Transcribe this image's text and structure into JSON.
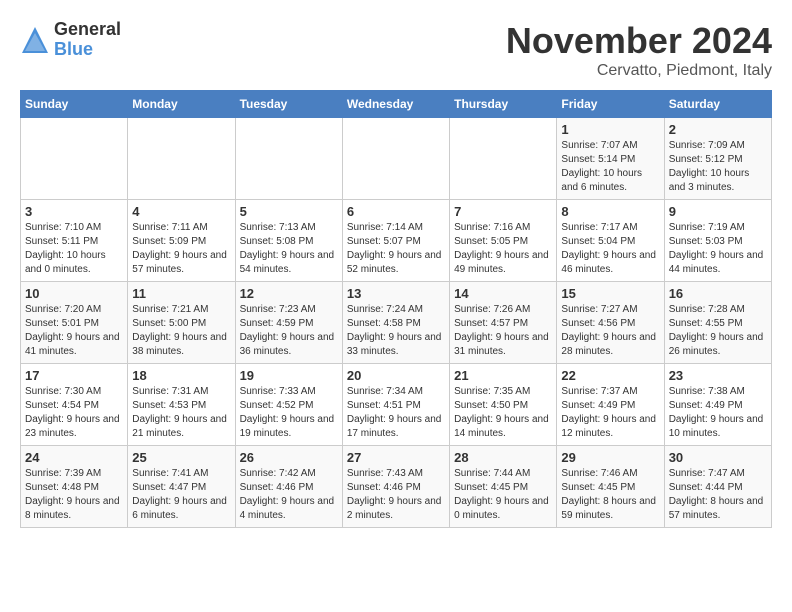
{
  "header": {
    "logo_general": "General",
    "logo_blue": "Blue",
    "month_title": "November 2024",
    "location": "Cervatto, Piedmont, Italy"
  },
  "weekdays": [
    "Sunday",
    "Monday",
    "Tuesday",
    "Wednesday",
    "Thursday",
    "Friday",
    "Saturday"
  ],
  "weeks": [
    [
      {
        "day": "",
        "info": ""
      },
      {
        "day": "",
        "info": ""
      },
      {
        "day": "",
        "info": ""
      },
      {
        "day": "",
        "info": ""
      },
      {
        "day": "",
        "info": ""
      },
      {
        "day": "1",
        "info": "Sunrise: 7:07 AM\nSunset: 5:14 PM\nDaylight: 10 hours and 6 minutes."
      },
      {
        "day": "2",
        "info": "Sunrise: 7:09 AM\nSunset: 5:12 PM\nDaylight: 10 hours and 3 minutes."
      }
    ],
    [
      {
        "day": "3",
        "info": "Sunrise: 7:10 AM\nSunset: 5:11 PM\nDaylight: 10 hours and 0 minutes."
      },
      {
        "day": "4",
        "info": "Sunrise: 7:11 AM\nSunset: 5:09 PM\nDaylight: 9 hours and 57 minutes."
      },
      {
        "day": "5",
        "info": "Sunrise: 7:13 AM\nSunset: 5:08 PM\nDaylight: 9 hours and 54 minutes."
      },
      {
        "day": "6",
        "info": "Sunrise: 7:14 AM\nSunset: 5:07 PM\nDaylight: 9 hours and 52 minutes."
      },
      {
        "day": "7",
        "info": "Sunrise: 7:16 AM\nSunset: 5:05 PM\nDaylight: 9 hours and 49 minutes."
      },
      {
        "day": "8",
        "info": "Sunrise: 7:17 AM\nSunset: 5:04 PM\nDaylight: 9 hours and 46 minutes."
      },
      {
        "day": "9",
        "info": "Sunrise: 7:19 AM\nSunset: 5:03 PM\nDaylight: 9 hours and 44 minutes."
      }
    ],
    [
      {
        "day": "10",
        "info": "Sunrise: 7:20 AM\nSunset: 5:01 PM\nDaylight: 9 hours and 41 minutes."
      },
      {
        "day": "11",
        "info": "Sunrise: 7:21 AM\nSunset: 5:00 PM\nDaylight: 9 hours and 38 minutes."
      },
      {
        "day": "12",
        "info": "Sunrise: 7:23 AM\nSunset: 4:59 PM\nDaylight: 9 hours and 36 minutes."
      },
      {
        "day": "13",
        "info": "Sunrise: 7:24 AM\nSunset: 4:58 PM\nDaylight: 9 hours and 33 minutes."
      },
      {
        "day": "14",
        "info": "Sunrise: 7:26 AM\nSunset: 4:57 PM\nDaylight: 9 hours and 31 minutes."
      },
      {
        "day": "15",
        "info": "Sunrise: 7:27 AM\nSunset: 4:56 PM\nDaylight: 9 hours and 28 minutes."
      },
      {
        "day": "16",
        "info": "Sunrise: 7:28 AM\nSunset: 4:55 PM\nDaylight: 9 hours and 26 minutes."
      }
    ],
    [
      {
        "day": "17",
        "info": "Sunrise: 7:30 AM\nSunset: 4:54 PM\nDaylight: 9 hours and 23 minutes."
      },
      {
        "day": "18",
        "info": "Sunrise: 7:31 AM\nSunset: 4:53 PM\nDaylight: 9 hours and 21 minutes."
      },
      {
        "day": "19",
        "info": "Sunrise: 7:33 AM\nSunset: 4:52 PM\nDaylight: 9 hours and 19 minutes."
      },
      {
        "day": "20",
        "info": "Sunrise: 7:34 AM\nSunset: 4:51 PM\nDaylight: 9 hours and 17 minutes."
      },
      {
        "day": "21",
        "info": "Sunrise: 7:35 AM\nSunset: 4:50 PM\nDaylight: 9 hours and 14 minutes."
      },
      {
        "day": "22",
        "info": "Sunrise: 7:37 AM\nSunset: 4:49 PM\nDaylight: 9 hours and 12 minutes."
      },
      {
        "day": "23",
        "info": "Sunrise: 7:38 AM\nSunset: 4:49 PM\nDaylight: 9 hours and 10 minutes."
      }
    ],
    [
      {
        "day": "24",
        "info": "Sunrise: 7:39 AM\nSunset: 4:48 PM\nDaylight: 9 hours and 8 minutes."
      },
      {
        "day": "25",
        "info": "Sunrise: 7:41 AM\nSunset: 4:47 PM\nDaylight: 9 hours and 6 minutes."
      },
      {
        "day": "26",
        "info": "Sunrise: 7:42 AM\nSunset: 4:46 PM\nDaylight: 9 hours and 4 minutes."
      },
      {
        "day": "27",
        "info": "Sunrise: 7:43 AM\nSunset: 4:46 PM\nDaylight: 9 hours and 2 minutes."
      },
      {
        "day": "28",
        "info": "Sunrise: 7:44 AM\nSunset: 4:45 PM\nDaylight: 9 hours and 0 minutes."
      },
      {
        "day": "29",
        "info": "Sunrise: 7:46 AM\nSunset: 4:45 PM\nDaylight: 8 hours and 59 minutes."
      },
      {
        "day": "30",
        "info": "Sunrise: 7:47 AM\nSunset: 4:44 PM\nDaylight: 8 hours and 57 minutes."
      }
    ]
  ]
}
